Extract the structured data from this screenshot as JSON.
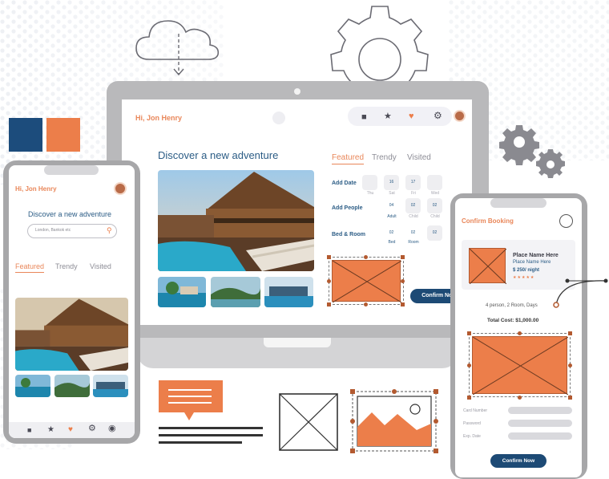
{
  "colors": {
    "navy": "#1c4c7c",
    "orange": "#ec7e4a",
    "dark_blue": "#1d4a75",
    "greeting_orange": "#e9875a",
    "title_blue": "#2b5c85"
  },
  "icons": {
    "cloud": "cloud-download-icon",
    "gear_large": "gear-icon",
    "gears_small": "gears-icon",
    "briefcase": "briefcase-icon",
    "star": "star-icon",
    "heart": "heart-icon",
    "settings": "settings-icon",
    "user": "user-icon",
    "search": "search-icon",
    "chat": "chat-bubble-icon",
    "image": "image-icon"
  },
  "laptop": {
    "greeting": "Hi, Jon Henry",
    "headline": "Discover a new adventure",
    "tabs": [
      "Featured",
      "Trendy",
      "Visited"
    ],
    "active_tab": "Featured",
    "booking": {
      "add_date": "Add Date",
      "add_people": "Add People",
      "bed_room": "Bed & Room",
      "date_chips": [
        {
          "value": "",
          "caption": "Thu"
        },
        {
          "value": "16",
          "caption": "Sat"
        },
        {
          "value": "17",
          "caption": "Fri"
        },
        {
          "value": "",
          "caption": "Wed"
        }
      ],
      "people_chips": [
        {
          "value": "04",
          "caption": "Adult"
        },
        {
          "value": "02",
          "caption": "Child"
        },
        {
          "value": "02",
          "caption": "Child"
        }
      ],
      "room_chips": [
        {
          "value": "02",
          "caption": "Bed"
        },
        {
          "value": "02",
          "caption": "Room"
        },
        {
          "value": "02",
          "caption": ""
        }
      ]
    },
    "confirm_label": "Confirm Now"
  },
  "phone_left": {
    "greeting": "Hi, Jon Henry",
    "headline": "Discover a new adventure",
    "search_placeholder": "London, Bankok etc",
    "tabs": [
      "Featured",
      "Trendy",
      "Visited"
    ],
    "active_tab": "Featured"
  },
  "phone_right": {
    "title": "Confirm Booking",
    "place_name": "Place Name Here",
    "place_sub": "Place Name Here",
    "price": "$ 250/ night",
    "stars": "★★★★★",
    "summary": "4 person, 2 Room, Days",
    "total": "Total Cost: $1,000.00",
    "fields": [
      "Card Number",
      "Password",
      "Exp. Date"
    ],
    "confirm_label": "Confirm Now"
  }
}
